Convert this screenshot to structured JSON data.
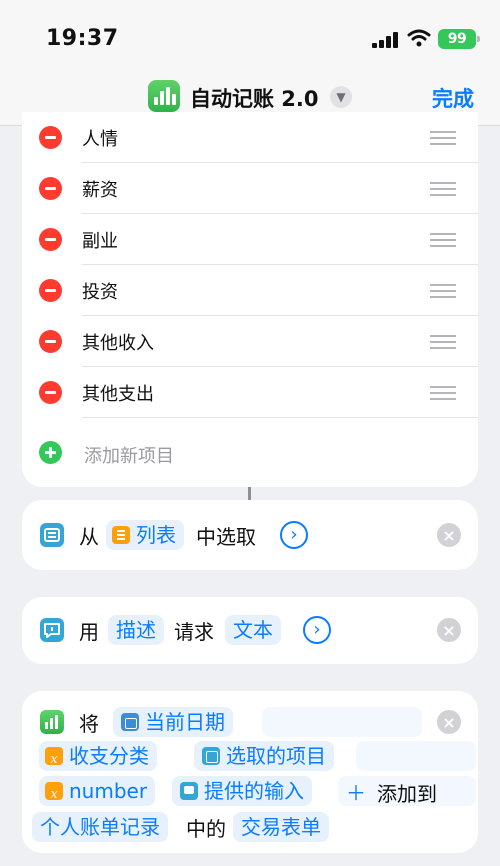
{
  "status": {
    "time": "19:37",
    "battery": "99"
  },
  "nav": {
    "title": "自动记账 2.0",
    "done": "完成"
  },
  "list": {
    "items": [
      "人情",
      "薪资",
      "副业",
      "投资",
      "其他收入",
      "其他支出"
    ],
    "add_placeholder": "添加新项目"
  },
  "action1": {
    "prefix": "从",
    "token": "列表",
    "suffix": "中选取"
  },
  "action2": {
    "prefix": "用",
    "token1": "描述",
    "middle": "请求",
    "token2": "文本"
  },
  "action3": {
    "prefix": "将",
    "token_date": "当前日期",
    "token_category": "收支分类",
    "token_selected": "选取的项目",
    "token_number": "number",
    "token_input": "提供的输入",
    "plus_text": "＋",
    "add_to": "添加到",
    "token_table": "个人账单记录",
    "of": "中的",
    "token_sheet": "交易表单"
  },
  "colors": {
    "accent": "#0a7cff",
    "delete": "#ff3b30",
    "add": "#34c759",
    "variable": "#ff9f0a"
  }
}
